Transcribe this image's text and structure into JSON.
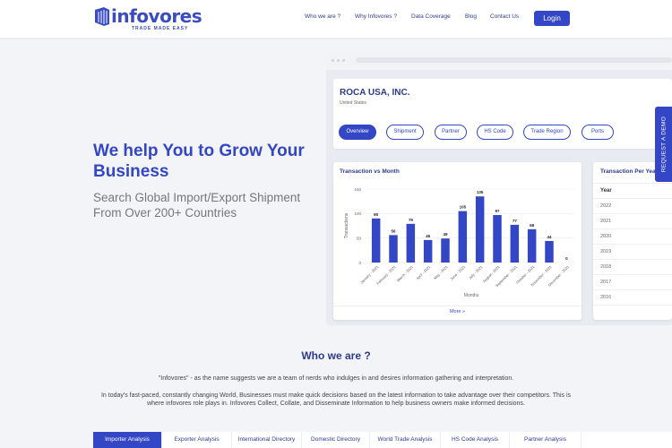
{
  "brand": {
    "name": "infovores",
    "tagline": "TRADE MADE EASY",
    "color": "#3346c6"
  },
  "nav": {
    "items": [
      "Who we are ?",
      "Why Infovores ?",
      "Data Coverage",
      "Blog",
      "Contact Us"
    ],
    "login": "Login"
  },
  "hero": {
    "title": "We help You to Grow Your Business",
    "subtitle": "Search Global Import/Export Shipment From Over 200+ Countries"
  },
  "mockup": {
    "company": "ROCA USA, INC.",
    "country": "United States",
    "tabs": [
      "Overview",
      "Shipment",
      "Partner",
      "HS Code",
      "Trade Region",
      "Ports"
    ],
    "active_tab": "Overview",
    "chart_more": "More »",
    "year_card": {
      "title": "Transaction Per Year",
      "header": "Year",
      "years": [
        "2022",
        "2021",
        "2020",
        "2019",
        "2018",
        "2017",
        "2016"
      ]
    }
  },
  "chart_data": {
    "type": "bar",
    "title": "Transaction vs Month",
    "xlabel": "Months",
    "ylabel": "Transactions",
    "ylim": [
      0,
      150
    ],
    "yticks": [
      0,
      50,
      100,
      150
    ],
    "categories": [
      "January - 2021",
      "February - 2021",
      "March - 2021",
      "April - 2021",
      "May - 2021",
      "June - 2021",
      "July - 2021",
      "August - 2021",
      "September - 2021",
      "October - 2021",
      "November - 2021",
      "December - 2021"
    ],
    "values": [
      90,
      56,
      79,
      46,
      49,
      105,
      135,
      97,
      77,
      68,
      44,
      0
    ],
    "bar_color": "#3346c6",
    "grid": true
  },
  "request_demo": "REQUEST A DEMO",
  "about": {
    "title": "Who we are ?",
    "p1": "\"Infovores\" - as the name suggests we are a team of nerds who indulges in and desires information gathering and interpretation.",
    "p2": "In today's fast-paced, constantly changing World, Businesses must make quick decisions based on the latest information to take advantage over their competitors. This is where infovores role plays in. Infovores Collect, Collate, and Disseminate Information to help business owners make informed decisions."
  },
  "bottom_tabs": [
    "Importer Analysis",
    "Exporter Analysis",
    "International Directory",
    "Domestic Directory",
    "World Trade Analysis",
    "HS Code Analysis",
    "Partner Analysis"
  ],
  "bottom_active": "Importer Analysis"
}
